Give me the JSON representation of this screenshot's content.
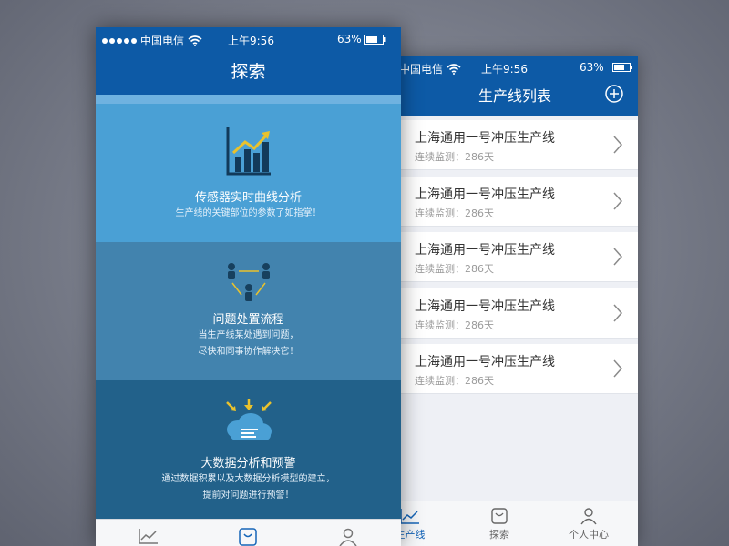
{
  "status_front": {
    "carrier": "中国电信",
    "time": "上午9:56",
    "battery": "63%"
  },
  "status_back": {
    "carrier": "中国电信",
    "time": "上午9:56",
    "battery": "63%"
  },
  "explore_screen": {
    "title": "探索",
    "sections": [
      {
        "title": "传感器实时曲线分析",
        "desc_lines": [
          "生产线的关键部位的参数了如指掌！"
        ],
        "icon": "line-chart-icon"
      },
      {
        "title": "问题处置流程",
        "desc_lines": [
          "当生产线某处遇到问题，",
          "尽快和同事协作解决它！"
        ],
        "icon": "team-workflow-icon"
      },
      {
        "title": "大数据分析和预警",
        "desc_lines": [
          "通过数据积累以及大数据分析模型的建立，",
          "提前对问题进行预警！"
        ],
        "icon": "cloud-data-icon"
      }
    ],
    "tabbar_icons": [
      "chart-tab-icon",
      "bag-tab-icon",
      "person-tab-icon"
    ]
  },
  "line_list_screen": {
    "title": "生产线列表",
    "add_icon": "add-circle-icon",
    "items": [
      {
        "name": "上海通用一号冲压生产线",
        "status": "连续监测：286天"
      },
      {
        "name": "上海通用一号冲压生产线",
        "status": "连续监测：286天"
      },
      {
        "name": "上海通用一号冲压生产线",
        "status": "连续监测：286天"
      },
      {
        "name": "上海通用一号冲压生产线",
        "status": "连续监测：286天"
      },
      {
        "name": "上海通用一号冲压生产线",
        "status": "连续监测：286天"
      }
    ],
    "tabs": [
      {
        "label": "生产线",
        "icon": "chart-tab-icon",
        "active": true
      },
      {
        "label": "探索",
        "icon": "bag-tab-icon",
        "active": false
      },
      {
        "label": "个人中心",
        "icon": "person-tab-icon",
        "active": false
      }
    ]
  },
  "colors": {
    "header_blue": "#0d5aa6",
    "section_1": "#4aa0d5",
    "section_2": "#4283ae",
    "section_3": "#22618a",
    "accent_yellow": "#e9c22d",
    "active_tab": "#1565b8"
  }
}
